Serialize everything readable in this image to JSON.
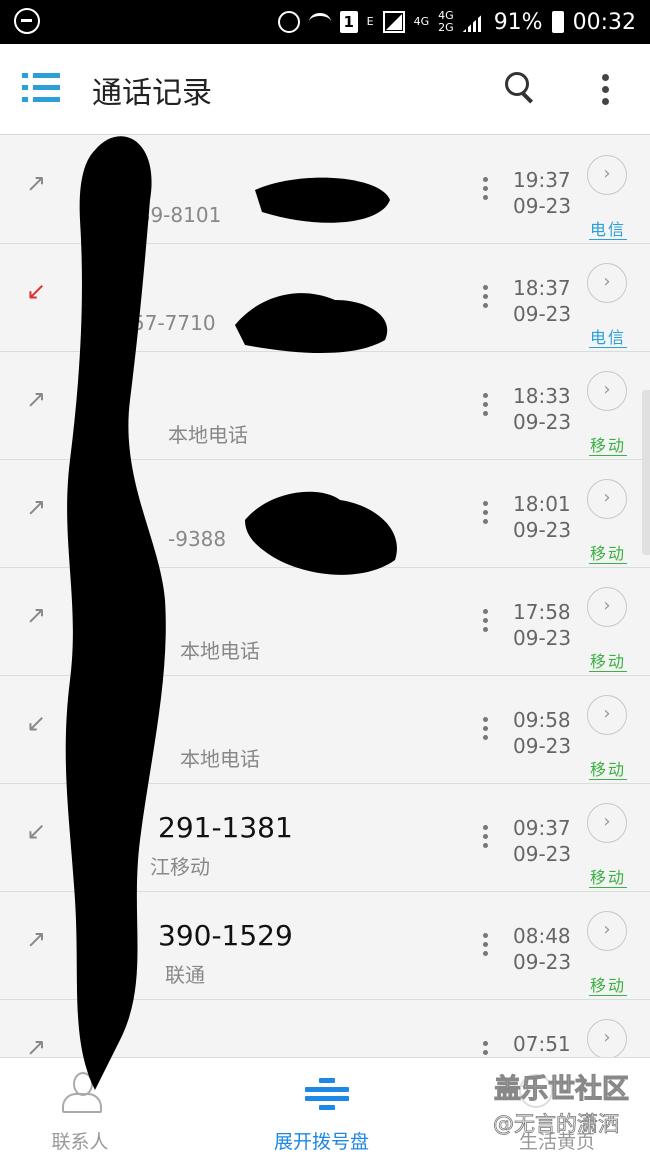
{
  "status_bar": {
    "left_icon": "dnd-minus-icon",
    "network_e": "E",
    "net_4g": "4G",
    "net_4g_2g_top": "4G",
    "net_4g_2g_bottom": "2G",
    "battery_percent": "91%",
    "time": "00:32"
  },
  "app_bar": {
    "title": "通话记录",
    "menu_icon": "list-menu-icon",
    "search_icon": "search-icon",
    "more_icon": "more-vert-icon"
  },
  "call_log": [
    {
      "direction": "outgoing",
      "arrow": "↗",
      "name": "",
      "sub": "389-8101",
      "time": "19:37",
      "date": "09-23",
      "carrier": "电信",
      "carrier_color": "#2a9fd8"
    },
    {
      "direction": "missed",
      "arrow": "↙",
      "name": "",
      "sub": "57-7710",
      "time": "18:37",
      "date": "09-23",
      "carrier": "电信",
      "carrier_color": "#2a9fd8"
    },
    {
      "direction": "outgoing",
      "arrow": "↗",
      "name": "",
      "sub": "本地电话",
      "time": "18:33",
      "date": "09-23",
      "carrier": "移动",
      "carrier_color": "#3cb043"
    },
    {
      "direction": "outgoing",
      "arrow": "↗",
      "name": "",
      "sub": "-9388",
      "time": "18:01",
      "date": "09-23",
      "carrier": "移动",
      "carrier_color": "#3cb043"
    },
    {
      "direction": "outgoing",
      "arrow": "↗",
      "name": "",
      "sub": "本地电话",
      "time": "17:58",
      "date": "09-23",
      "carrier": "移动",
      "carrier_color": "#3cb043"
    },
    {
      "direction": "incoming",
      "arrow": "↙",
      "name": "",
      "sub": "本地电话",
      "time": "09:58",
      "date": "09-23",
      "carrier": "移动",
      "carrier_color": "#3cb043"
    },
    {
      "direction": "incoming",
      "arrow": "↙",
      "name": "291-1381",
      "sub": "江移动",
      "time": "09:37",
      "date": "09-23",
      "carrier": "移动",
      "carrier_color": "#3cb043"
    },
    {
      "direction": "outgoing",
      "arrow": "↗",
      "name": "390-1529",
      "sub": "联通",
      "time": "08:48",
      "date": "09-23",
      "carrier": "移动",
      "carrier_color": "#3cb043"
    },
    {
      "direction": "outgoing",
      "arrow": "↗",
      "name": "",
      "sub": "",
      "time": "07:51",
      "date": "",
      "carrier": "",
      "carrier_color": "#3cb043"
    }
  ],
  "bottom_nav": {
    "tabs": [
      {
        "label": "联系人",
        "icon": "person-icon",
        "active": false
      },
      {
        "label": "展开拨号盘",
        "icon": "dialpad-icon",
        "active": true
      },
      {
        "label": "生活黄页",
        "icon": "yellow-pages-icon",
        "active": false
      }
    ]
  },
  "watermark": {
    "line1": "盖乐世社区",
    "line2": "@无言的潇洒"
  },
  "colors": {
    "accent": "#1e88e5",
    "missed": "#e02d2d",
    "telecom": "#2a9fd8",
    "mobile": "#3cb043"
  }
}
